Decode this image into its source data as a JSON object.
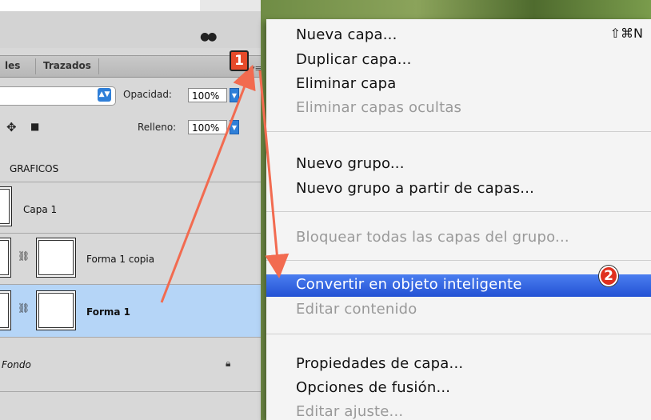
{
  "layers_panel": {
    "tabs": [
      "les",
      "Trazados"
    ],
    "opacity_label": "Opacidad:",
    "opacity_value": "100%",
    "fill_label": "Relleno:",
    "fill_value": "100%",
    "group_name": "GRAFICOS",
    "layers": [
      {
        "name": "Capa 1"
      },
      {
        "name": "Forma 1 copia"
      },
      {
        "name": "Forma 1",
        "selected": true
      },
      {
        "name": "Fondo"
      }
    ]
  },
  "context_menu": {
    "items": [
      {
        "label": "Nueva capa...",
        "shortcut": "⇧⌘N",
        "enabled": true
      },
      {
        "label": "Duplicar capa...",
        "enabled": true
      },
      {
        "label": "Eliminar capa",
        "enabled": true
      },
      {
        "label": "Eliminar capas ocultas",
        "enabled": false
      },
      {
        "label": "Nuevo grupo...",
        "enabled": true
      },
      {
        "label": "Nuevo grupo a partir de capas...",
        "enabled": true
      },
      {
        "label": "Bloquear todas las capas del grupo...",
        "enabled": false
      },
      {
        "label": "Convertir en objeto inteligente",
        "enabled": true,
        "highlighted": true
      },
      {
        "label": "Editar contenido",
        "enabled": false
      },
      {
        "label": "Propiedades de capa...",
        "enabled": true
      },
      {
        "label": "Opciones de fusión...",
        "enabled": true
      },
      {
        "label": "Editar ajuste...",
        "enabled": false
      }
    ]
  },
  "annotations": {
    "step1": "1",
    "step2": "2",
    "arrow_color": "#f26b50"
  }
}
